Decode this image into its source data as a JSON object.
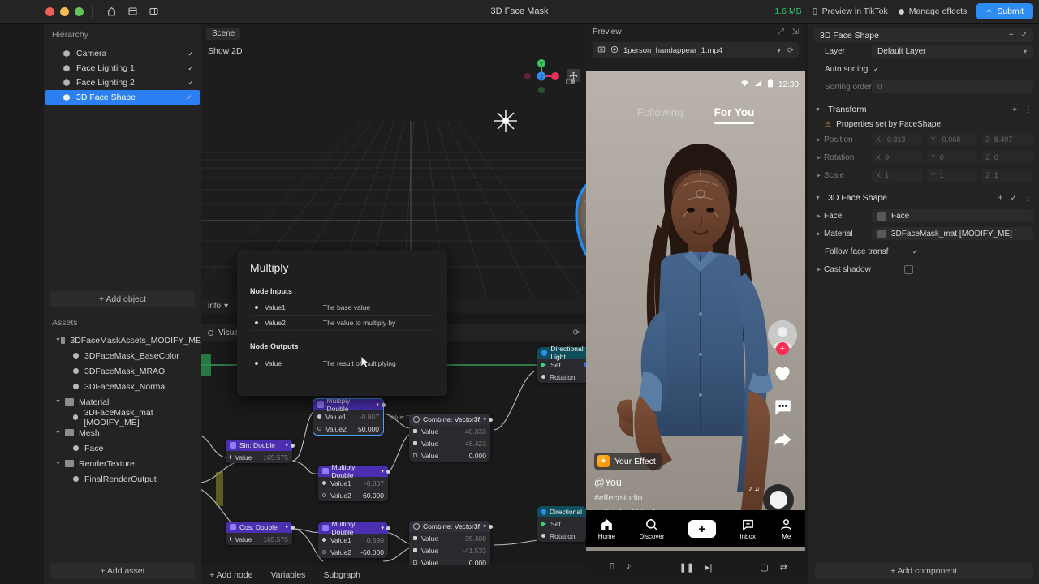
{
  "topbar": {
    "title": "3D Face Mask",
    "size_badge": "1.6 MB",
    "preview_tiktok": "Preview in TikTok",
    "manage_effects": "Manage effects",
    "submit": "Submit",
    "icons": [
      "home-icon",
      "layout-icon",
      "panel-icon"
    ]
  },
  "hierarchy": {
    "header": "Hierarchy",
    "items": [
      {
        "label": "Camera",
        "selected": false,
        "checked": true
      },
      {
        "label": "Face Lighting 1",
        "selected": false,
        "checked": true
      },
      {
        "label": "Face Lighting 2",
        "selected": false,
        "checked": true
      },
      {
        "label": "3D Face Shape",
        "selected": true,
        "checked": true
      }
    ],
    "add_object": "+ Add object"
  },
  "assets": {
    "header": "Assets",
    "items": [
      {
        "label": "3DFaceMaskAssets_MODIFY_ME",
        "type": "folder",
        "depth": 0
      },
      {
        "label": "3DFaceMask_BaseColor",
        "type": "file",
        "depth": 1
      },
      {
        "label": "3DFaceMask_MRAO",
        "type": "file",
        "depth": 1
      },
      {
        "label": "3DFaceMask_Normal",
        "type": "file",
        "depth": 1
      },
      {
        "label": "Material",
        "type": "folder",
        "depth": 0
      },
      {
        "label": "3DFaceMask_mat [MODIFY_ME]",
        "type": "file",
        "depth": 1
      },
      {
        "label": "Mesh",
        "type": "folder",
        "depth": 0
      },
      {
        "label": "Face",
        "type": "file",
        "depth": 1
      },
      {
        "label": "RenderTexture",
        "type": "folder",
        "depth": 0
      },
      {
        "label": "FinalRenderOutput",
        "type": "file",
        "depth": 1
      }
    ],
    "add_asset": "+ Add asset"
  },
  "scene": {
    "tab": "Scene",
    "show_2d": "Show 2D",
    "tools": [
      "move-tool-icon",
      "rotate-tool-icon",
      "scale-tool-icon",
      "rect-tool-icon"
    ],
    "info_label": "info"
  },
  "graph": {
    "visual_scripting_label": "Visual scripting",
    "bottom_bar": [
      "+ Add node",
      "Variables",
      "Subgraph"
    ],
    "nodes": [
      {
        "title": "Multiply: Double",
        "style": "purple",
        "selected": true,
        "rows": [
          {
            "label": "Value1",
            "value": "-0.807"
          },
          {
            "label": "Value2",
            "value": "50.000",
            "bold": true
          }
        ]
      },
      {
        "title": "Sin: Double",
        "style": "purple",
        "selected": false,
        "rows": [
          {
            "label": "Value",
            "value": "165.575"
          }
        ]
      },
      {
        "title": "Multiply: Double",
        "style": "purple",
        "selected": false,
        "rows": [
          {
            "label": "Value1",
            "value": "-0.807"
          },
          {
            "label": "Value2",
            "value": "60.000",
            "bold": true
          }
        ]
      },
      {
        "title": "Cos: Double",
        "style": "purple",
        "selected": false,
        "rows": [
          {
            "label": "Value",
            "value": "165.575"
          }
        ]
      },
      {
        "title": "Multiply: Double",
        "style": "purple",
        "selected": false,
        "rows": [
          {
            "label": "Value1",
            "value": "0.590"
          },
          {
            "label": "Value2",
            "value": "-60.000",
            "bold": true
          }
        ]
      },
      {
        "title": "Combine: Vector3f",
        "style": "dark",
        "selected": false,
        "rows": [
          {
            "label": "Value",
            "value": "-40.333"
          },
          {
            "label": "Value",
            "value": "-48.423"
          },
          {
            "label": "Value",
            "value": "0.000",
            "bold": true
          }
        ]
      },
      {
        "title": "Combine: Vector3f",
        "style": "dark",
        "selected": false,
        "rows": [
          {
            "label": "Value",
            "value": "-35.408"
          },
          {
            "label": "Value",
            "value": "-41.533"
          },
          {
            "label": "Value",
            "value": "0.000",
            "bold": true
          }
        ]
      },
      {
        "title": "Directional Light",
        "style": "teal",
        "selected": false,
        "rows": [
          {
            "label": "Set",
            "value": ""
          },
          {
            "label": "Rotation",
            "value": ""
          }
        ]
      },
      {
        "title": "Directional",
        "style": "teal",
        "selected": false,
        "rows": [
          {
            "label": "Set",
            "value": ""
          },
          {
            "label": "Rotation",
            "value": ""
          }
        ]
      }
    ],
    "wire_label": "Value: Dou"
  },
  "tooltip": {
    "title": "Multiply",
    "inputs_header": "Node Inputs",
    "inputs": [
      {
        "name": "Value1",
        "desc": "The base value"
      },
      {
        "name": "Value2",
        "desc": "The value to multiply by"
      }
    ],
    "outputs_header": "Node Outputs",
    "outputs": [
      {
        "name": "Value",
        "desc": "The result of multiplying"
      }
    ]
  },
  "preview": {
    "header": "Preview",
    "file_name": "1person_handappear_1.mp4",
    "phone": {
      "time": "12:30",
      "tab_following": "Following",
      "tab_foryou": "For You",
      "effect_label": "Your Effect",
      "username": "@You",
      "hashtag": "#effectstudio",
      "music": "Original Music",
      "nav": [
        {
          "label": "Home",
          "icon": "home-icon"
        },
        {
          "label": "Discover",
          "icon": "search-icon"
        },
        {
          "label": "",
          "icon": "plus-icon"
        },
        {
          "label": "Inbox",
          "icon": "inbox-icon"
        },
        {
          "label": "Me",
          "icon": "person-icon"
        }
      ]
    }
  },
  "inspector": {
    "title": "3D Face Shape",
    "layer_label": "Layer",
    "layer_value": "Default Layer",
    "auto_sorting_label": "Auto sorting",
    "sorting_order_label": "Sorting order",
    "sorting_order_value": "0",
    "transform_section": "Transform",
    "properties_warning": "Properties set by FaceShape",
    "position_label": "Position",
    "position": [
      "-0.313",
      "-0.968",
      "8.497"
    ],
    "rotation_label": "Rotation",
    "rotation": [
      "0",
      "0",
      "0"
    ],
    "scale_label": "Scale",
    "scale": [
      "1",
      "1",
      "1"
    ],
    "faceshape_section": "3D Face Shape",
    "face_label": "Face",
    "face_value": "Face",
    "material_label": "Material",
    "material_value": "3DFaceMask_mat [MODIFY_ME]",
    "follow_face_label": "Follow face transf",
    "cast_shadow_label": "Cast shadow",
    "add_component": "+ Add component"
  },
  "colors": {
    "accent": "#2e8cf0",
    "node_purple": "#4b2fb0",
    "node_teal": "#0f4f5c",
    "select_blue": "#2c7ff0",
    "size_green": "#2ecc71",
    "tiktok_red": "#fe2c55",
    "tiktok_cyan": "#25f4ee"
  }
}
